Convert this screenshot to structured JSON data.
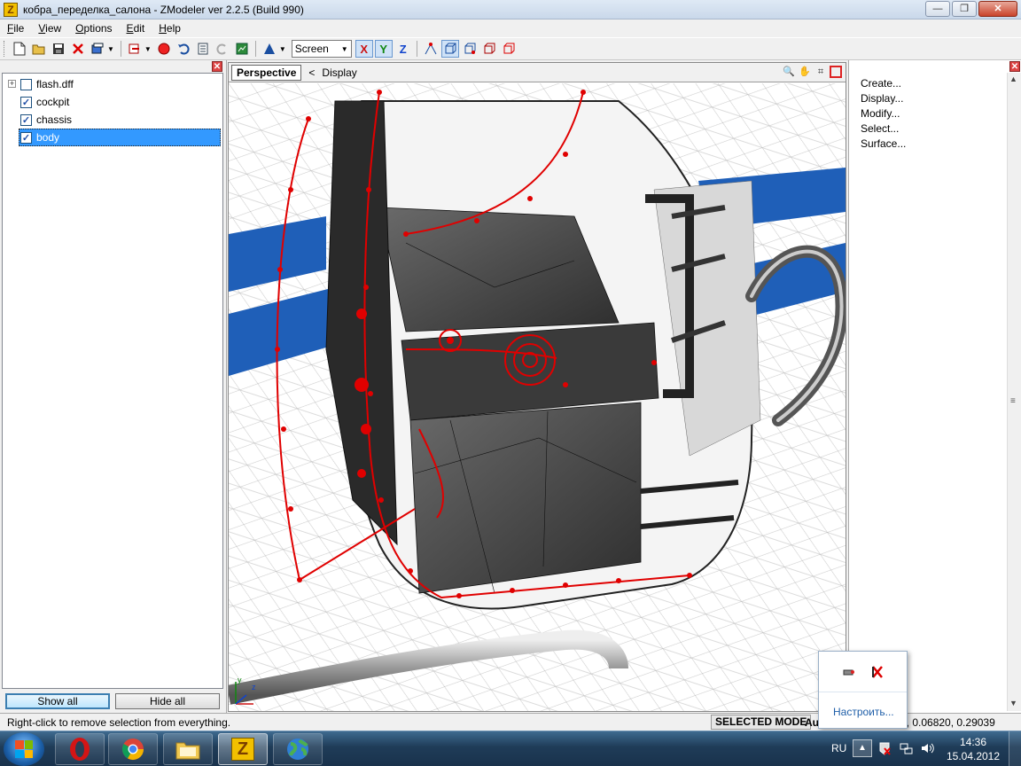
{
  "window": {
    "title": "кобра_переделка_салона - ZModeler ver 2.2.5 (Build 990)",
    "app_icon_glyph": "Z",
    "controls": {
      "minimize": "—",
      "maximize": "❐",
      "close": "✕"
    }
  },
  "menu": {
    "file": {
      "hotkey": "F",
      "rest": "ile"
    },
    "view": {
      "hotkey": "V",
      "rest": "iew"
    },
    "options": {
      "hotkey": "O",
      "rest": "ptions"
    },
    "edit": {
      "hotkey": "E",
      "rest": "dit"
    },
    "help": {
      "hotkey": "H",
      "rest": "elp"
    }
  },
  "toolbar": {
    "view_select": "Screen",
    "axis_x": "X",
    "axis_y": "Y",
    "axis_z": "Z",
    "colors": {
      "x": "#cc1111",
      "y": "#118811",
      "z": "#1144cc"
    }
  },
  "tree": {
    "close_glyph": "✕",
    "items": [
      {
        "label": "flash.dff",
        "checked": false,
        "expander": "+"
      },
      {
        "label": "cockpit",
        "checked": true
      },
      {
        "label": "chassis",
        "checked": true
      },
      {
        "label": "body",
        "checked": true
      }
    ],
    "check_glyph": "✓",
    "show_all": "Show all",
    "hide_all": "Hide all"
  },
  "viewport": {
    "tab": "Perspective",
    "back_arrow": "<",
    "breadcrumb": "Display",
    "axis_labels": {
      "y": "y",
      "z": "z"
    },
    "tool_glyphs": {
      "zoom": "🔍",
      "pan": "✋",
      "fit": "⌗"
    }
  },
  "right_panel": {
    "close_glyph": "✕",
    "items": [
      "Create...",
      "Display...",
      "Modify...",
      "Select...",
      "Surface..."
    ],
    "scroll_up": "▲",
    "scroll_down": "▼",
    "scroll_grip": "≡"
  },
  "status": {
    "hint": "Right-click to remove selection from everything.",
    "mode": "SELECTED MODE",
    "mode_extra": "Au",
    "coords": "9, 0.06820, 0.29039"
  },
  "tray_popup": {
    "customize": "Настроить..."
  },
  "taskbar": {
    "language": "RU",
    "time": "14:36",
    "date": "15.04.2012",
    "tray_overflow": "▲",
    "zmodeler_glyph": "Z"
  },
  "colors": {
    "wire_red": "#e00000",
    "stripe_blue": "#1f5fb8",
    "panel_dark": "#3c3c3c",
    "selection_blue": "#3399ff"
  }
}
